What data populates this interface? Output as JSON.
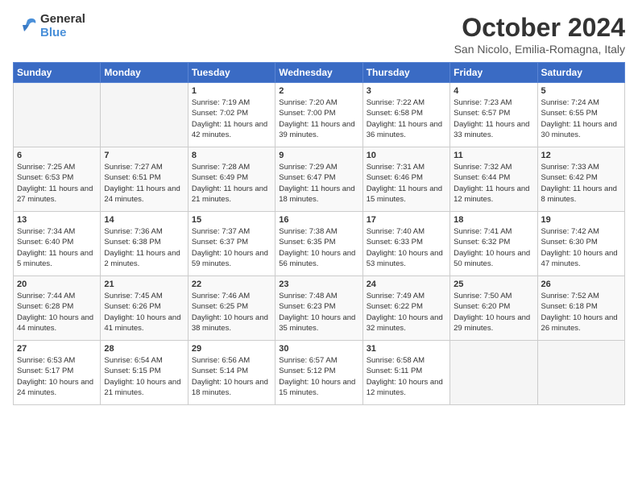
{
  "logo": {
    "line1": "General",
    "line2": "Blue"
  },
  "title": "October 2024",
  "subtitle": "San Nicolo, Emilia-Romagna, Italy",
  "days_of_week": [
    "Sunday",
    "Monday",
    "Tuesday",
    "Wednesday",
    "Thursday",
    "Friday",
    "Saturday"
  ],
  "weeks": [
    [
      {
        "day": "",
        "detail": ""
      },
      {
        "day": "",
        "detail": ""
      },
      {
        "day": "1",
        "detail": "Sunrise: 7:19 AM\nSunset: 7:02 PM\nDaylight: 11 hours and 42 minutes."
      },
      {
        "day": "2",
        "detail": "Sunrise: 7:20 AM\nSunset: 7:00 PM\nDaylight: 11 hours and 39 minutes."
      },
      {
        "day": "3",
        "detail": "Sunrise: 7:22 AM\nSunset: 6:58 PM\nDaylight: 11 hours and 36 minutes."
      },
      {
        "day": "4",
        "detail": "Sunrise: 7:23 AM\nSunset: 6:57 PM\nDaylight: 11 hours and 33 minutes."
      },
      {
        "day": "5",
        "detail": "Sunrise: 7:24 AM\nSunset: 6:55 PM\nDaylight: 11 hours and 30 minutes."
      }
    ],
    [
      {
        "day": "6",
        "detail": "Sunrise: 7:25 AM\nSunset: 6:53 PM\nDaylight: 11 hours and 27 minutes."
      },
      {
        "day": "7",
        "detail": "Sunrise: 7:27 AM\nSunset: 6:51 PM\nDaylight: 11 hours and 24 minutes."
      },
      {
        "day": "8",
        "detail": "Sunrise: 7:28 AM\nSunset: 6:49 PM\nDaylight: 11 hours and 21 minutes."
      },
      {
        "day": "9",
        "detail": "Sunrise: 7:29 AM\nSunset: 6:47 PM\nDaylight: 11 hours and 18 minutes."
      },
      {
        "day": "10",
        "detail": "Sunrise: 7:31 AM\nSunset: 6:46 PM\nDaylight: 11 hours and 15 minutes."
      },
      {
        "day": "11",
        "detail": "Sunrise: 7:32 AM\nSunset: 6:44 PM\nDaylight: 11 hours and 12 minutes."
      },
      {
        "day": "12",
        "detail": "Sunrise: 7:33 AM\nSunset: 6:42 PM\nDaylight: 11 hours and 8 minutes."
      }
    ],
    [
      {
        "day": "13",
        "detail": "Sunrise: 7:34 AM\nSunset: 6:40 PM\nDaylight: 11 hours and 5 minutes."
      },
      {
        "day": "14",
        "detail": "Sunrise: 7:36 AM\nSunset: 6:38 PM\nDaylight: 11 hours and 2 minutes."
      },
      {
        "day": "15",
        "detail": "Sunrise: 7:37 AM\nSunset: 6:37 PM\nDaylight: 10 hours and 59 minutes."
      },
      {
        "day": "16",
        "detail": "Sunrise: 7:38 AM\nSunset: 6:35 PM\nDaylight: 10 hours and 56 minutes."
      },
      {
        "day": "17",
        "detail": "Sunrise: 7:40 AM\nSunset: 6:33 PM\nDaylight: 10 hours and 53 minutes."
      },
      {
        "day": "18",
        "detail": "Sunrise: 7:41 AM\nSunset: 6:32 PM\nDaylight: 10 hours and 50 minutes."
      },
      {
        "day": "19",
        "detail": "Sunrise: 7:42 AM\nSunset: 6:30 PM\nDaylight: 10 hours and 47 minutes."
      }
    ],
    [
      {
        "day": "20",
        "detail": "Sunrise: 7:44 AM\nSunset: 6:28 PM\nDaylight: 10 hours and 44 minutes."
      },
      {
        "day": "21",
        "detail": "Sunrise: 7:45 AM\nSunset: 6:26 PM\nDaylight: 10 hours and 41 minutes."
      },
      {
        "day": "22",
        "detail": "Sunrise: 7:46 AM\nSunset: 6:25 PM\nDaylight: 10 hours and 38 minutes."
      },
      {
        "day": "23",
        "detail": "Sunrise: 7:48 AM\nSunset: 6:23 PM\nDaylight: 10 hours and 35 minutes."
      },
      {
        "day": "24",
        "detail": "Sunrise: 7:49 AM\nSunset: 6:22 PM\nDaylight: 10 hours and 32 minutes."
      },
      {
        "day": "25",
        "detail": "Sunrise: 7:50 AM\nSunset: 6:20 PM\nDaylight: 10 hours and 29 minutes."
      },
      {
        "day": "26",
        "detail": "Sunrise: 7:52 AM\nSunset: 6:18 PM\nDaylight: 10 hours and 26 minutes."
      }
    ],
    [
      {
        "day": "27",
        "detail": "Sunrise: 6:53 AM\nSunset: 5:17 PM\nDaylight: 10 hours and 24 minutes."
      },
      {
        "day": "28",
        "detail": "Sunrise: 6:54 AM\nSunset: 5:15 PM\nDaylight: 10 hours and 21 minutes."
      },
      {
        "day": "29",
        "detail": "Sunrise: 6:56 AM\nSunset: 5:14 PM\nDaylight: 10 hours and 18 minutes."
      },
      {
        "day": "30",
        "detail": "Sunrise: 6:57 AM\nSunset: 5:12 PM\nDaylight: 10 hours and 15 minutes."
      },
      {
        "day": "31",
        "detail": "Sunrise: 6:58 AM\nSunset: 5:11 PM\nDaylight: 10 hours and 12 minutes."
      },
      {
        "day": "",
        "detail": ""
      },
      {
        "day": "",
        "detail": ""
      }
    ]
  ]
}
